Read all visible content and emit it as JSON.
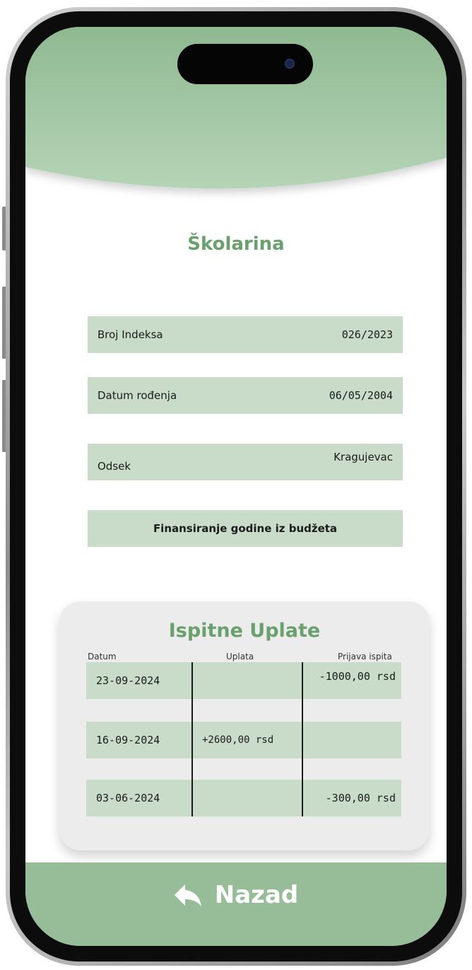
{
  "title": "Školarina",
  "info": {
    "broj_indeksa_label": "Broj Indeksa",
    "broj_indeksa_value": "026/2023",
    "datum_rodenja_label": "Datum rođenja",
    "datum_rodenja_value": "06/05/2004",
    "odsek_label": "Odsek",
    "odsek_value": "Kragujevac",
    "finansiranje": "Finansiranje godine iz budžeta"
  },
  "payments": {
    "title": "Ispitne Uplate",
    "columns": [
      "Datum",
      "Uplata",
      "Prijava ispita"
    ],
    "rows": [
      {
        "datum": "23-09-2024",
        "uplata": "",
        "prijava": "-1000,00 rsd"
      },
      {
        "datum": "16-09-2024",
        "uplata": "+2600,00 rsd",
        "prijava": ""
      },
      {
        "datum": "03-06-2024",
        "uplata": "",
        "prijava": "-300,00 rsd"
      }
    ]
  },
  "footer": {
    "back_label": "Nazad",
    "back_icon": "reply-arrow-icon"
  },
  "colors": {
    "accent": "#6aa06e",
    "header_top": "#8fb991",
    "header_bottom": "#b5d4b6",
    "row_bg": "#c8dcc9",
    "footer_bg": "#97bd98",
    "card_bg": "#ececec"
  }
}
